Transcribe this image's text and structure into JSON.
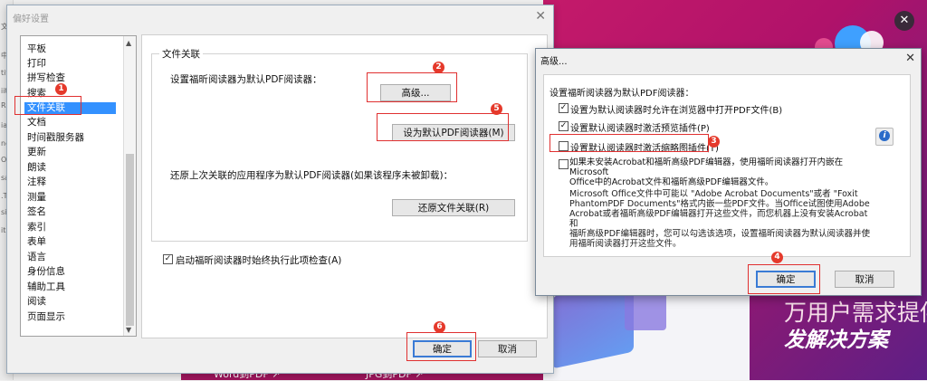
{
  "background": {
    "left_edge_glyphs": [
      "文",
      "中",
      "tit",
      "iit",
      "RH",
      "ia",
      "ne",
      "O",
      "sa",
      ".T",
      "sit",
      "itl"
    ],
    "banner_text_line1": "万用户需求提供",
    "banner_text_line2": "发解决方案",
    "links": [
      "Word到PDF ↗",
      "JPG到PDF ↗"
    ],
    "close_glyph": "✕"
  },
  "main_dialog": {
    "title": "偏好设置",
    "close_glyph": "✕",
    "categories": [
      "平板",
      "打印",
      "拼写检查",
      "搜索",
      "文件关联",
      "文档",
      "时间戳服务器",
      "更新",
      "朗读",
      "注释",
      "测量",
      "签名",
      "索引",
      "表单",
      "语言",
      "身份信息",
      "辅助工具",
      "阅读",
      "页面显示"
    ],
    "selected_category": "文件关联",
    "group_title": "文件关联",
    "set_default_label": "设置福昕阅读器为默认PDF阅读器：",
    "advanced_button": "高级...",
    "set_default_button": "设为默认PDF阅读器(M)",
    "restore_label": "还原上次关联的应用程序为默认PDF阅读器(如果该程序未被卸载)：",
    "restore_button": "还原文件关联(R)",
    "startup_check_label": "启动福昕阅读器时始终执行此项检查(A)",
    "startup_check_checked": true,
    "ok_button": "确定",
    "cancel_button": "取消"
  },
  "advanced_dialog": {
    "title": "高级...",
    "close_glyph": "✕",
    "heading": "设置福昕阅读器为默认PDF阅读器：",
    "options": [
      {
        "label": "设置为默认阅读器时允许在浏览器中打开PDF文件(B)",
        "checked": true
      },
      {
        "label": "设置默认阅读器时激活预览插件(P)",
        "checked": true
      },
      {
        "label": "设置默认阅读器时激活缩略图插件(T)",
        "checked": false
      }
    ],
    "office_option": {
      "line1": "如果未安装Acrobat和福昕高级PDF编辑器，使用福昕阅读器打开内嵌在Microsoft",
      "line2": "Office中的Acrobat文件和福昕高级PDF编辑器文件。",
      "checked": false
    },
    "description": [
      "Microsoft Office文件中可能以 \"Adobe Acrobat Documents\"或者 \"Foxit",
      "PhantomPDF Documents\"格式内嵌一些PDF文件。当Office试图使用Adobe",
      "Acrobat或者福昕高级PDF编辑器打开这些文件，而您机器上没有安装Acrobat和",
      "福昕高级PDF编辑器时，您可以勾选该选项，设置福昕阅读器为默认阅读器并使",
      "用福昕阅读器打开这些文件。"
    ],
    "info_glyph": "i",
    "ok_button": "确定",
    "cancel_button": "取消"
  },
  "badges": [
    "1",
    "2",
    "3",
    "4",
    "5",
    "6"
  ],
  "colors": {
    "badge": "#e5392b",
    "highlight_box": "#e03030",
    "selection": "#3391ff"
  }
}
